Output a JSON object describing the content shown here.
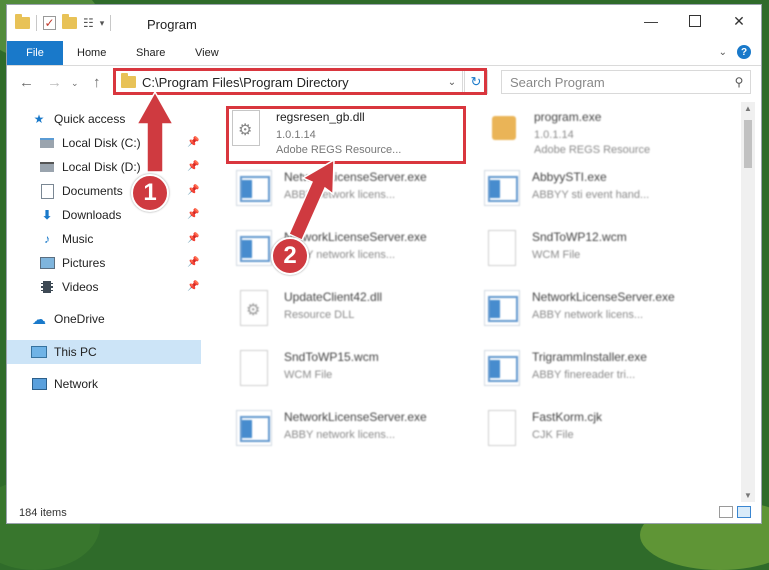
{
  "window": {
    "title": "Program"
  },
  "ribbon": {
    "tabs": [
      "File",
      "Home",
      "Share",
      "View"
    ]
  },
  "address": {
    "path": "C:\\Program Files\\Program Directory"
  },
  "search": {
    "placeholder": "Search Program"
  },
  "sidebar": {
    "items": [
      {
        "label": "Quick access",
        "icon": "star-icon"
      },
      {
        "label": "Local Disk (C:)",
        "icon": "drive-icon"
      },
      {
        "label": "Local Disk (D:)",
        "icon": "drive-icon"
      },
      {
        "label": "Documents",
        "icon": "documents-icon"
      },
      {
        "label": "Downloads",
        "icon": "download-arrow-icon"
      },
      {
        "label": "Music",
        "icon": "music-note-icon"
      },
      {
        "label": "Pictures",
        "icon": "pictures-icon"
      },
      {
        "label": "Videos",
        "icon": "film-icon"
      },
      {
        "label": "OneDrive",
        "icon": "cloud-icon"
      },
      {
        "label": "This PC",
        "icon": "monitor-icon"
      },
      {
        "label": "Network",
        "icon": "network-icon"
      }
    ]
  },
  "files": [
    {
      "name": "regsresen_gb.dll",
      "line1": "1.0.1.14",
      "line2": "Adobe REGS Resource...",
      "kind": "dll"
    },
    {
      "name": "program.exe",
      "line1": "1.0.1.14",
      "line2": "Adobe REGS Resource",
      "kind": "exe-special"
    },
    {
      "name": "NetworkLicenseServer.exe",
      "line1": "ABBY network licens...",
      "kind": "app"
    },
    {
      "name": "AbbyySTI.exe",
      "line1": "ABBYY sti event hand...",
      "kind": "app"
    },
    {
      "name": "NetworkLicenseServer.exe",
      "line1": "ABBY network licens...",
      "kind": "app"
    },
    {
      "name": "SndToWP12.wcm",
      "line1": "WCM File",
      "kind": "doc"
    },
    {
      "name": "UpdateClient42.dll",
      "line1": "Resource DLL",
      "kind": "dll"
    },
    {
      "name": "NetworkLicenseServer.exe",
      "line1": "ABBY network licens...",
      "kind": "app"
    },
    {
      "name": "SndToWP15.wcm",
      "line1": "WCM File",
      "kind": "doc"
    },
    {
      "name": "TrigrammInstaller.exe",
      "line1": "ABBY finereader tri...",
      "kind": "app"
    },
    {
      "name": "NetworkLicenseServer.exe",
      "line1": "ABBY network licens...",
      "kind": "app"
    },
    {
      "name": "FastKorm.cjk",
      "line1": "CJK File",
      "kind": "doc"
    }
  ],
  "status": {
    "count": "184 items"
  },
  "annotations": {
    "badge1": "1",
    "badge2": "2",
    "color": "#cf3a40"
  }
}
